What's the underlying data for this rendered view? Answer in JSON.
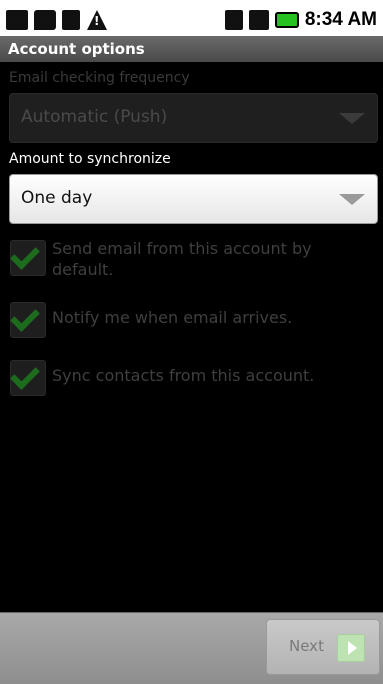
{
  "status_bar": {
    "time": "8:34 AM",
    "icons": [
      "notification-icon",
      "message-icon",
      "usb-icon",
      "warning-icon",
      "3g-icon",
      "signal-icon",
      "battery-icon"
    ]
  },
  "title": "Account options",
  "email_frequency": {
    "label": "Email checking frequency",
    "value": "Automatic (Push)",
    "enabled": false
  },
  "sync_amount": {
    "label": "Amount to synchronize",
    "value": "One day",
    "enabled": true
  },
  "checkboxes": [
    {
      "label": "Send email from this account by default.",
      "checked": true,
      "enabled": false
    },
    {
      "label": "Notify me when email arrives.",
      "checked": true,
      "enabled": false
    },
    {
      "label": "Sync contacts from this account.",
      "checked": true,
      "enabled": false
    }
  ],
  "buttons": {
    "next": "Next"
  },
  "colors": {
    "accent_green": "#25c21f",
    "title_bar": "#5a5a5a"
  }
}
